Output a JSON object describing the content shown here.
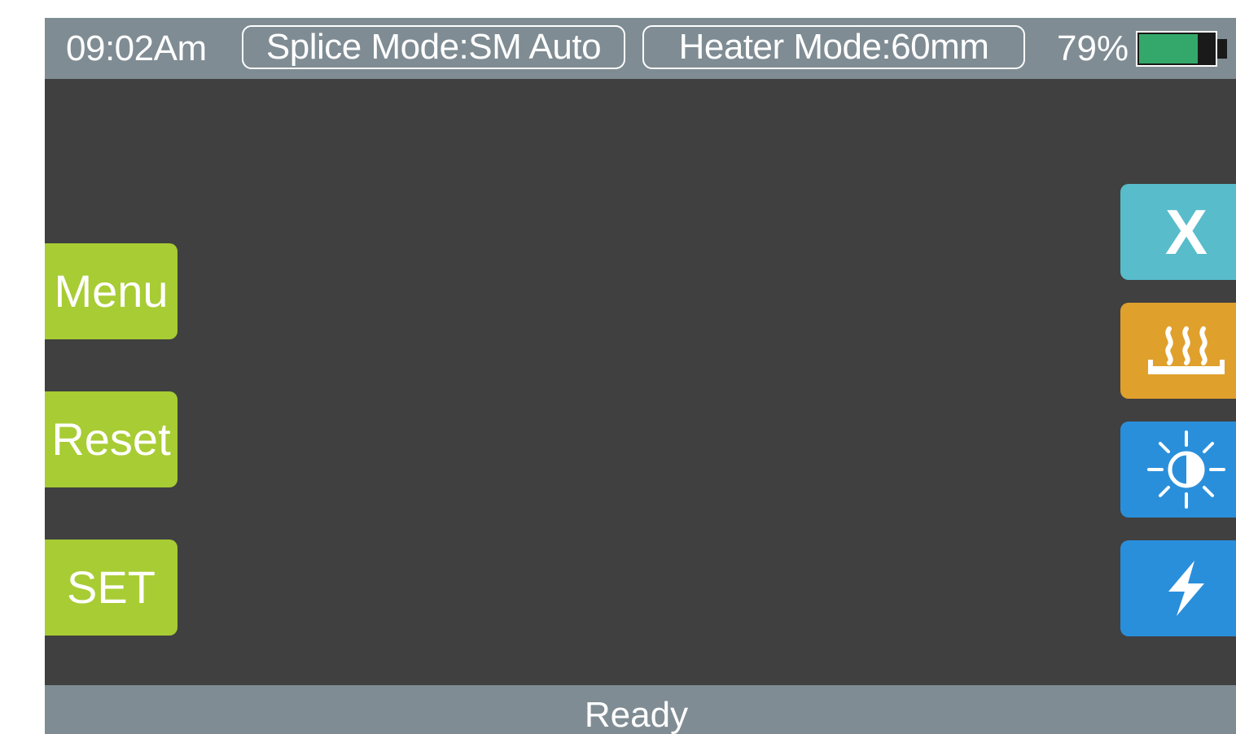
{
  "header": {
    "time": "09:02Am",
    "splice_mode": "Splice Mode:SM Auto",
    "heater_mode": "Heater Mode:60mm",
    "battery_percent_label": "79%",
    "battery_level": 0.79
  },
  "left_buttons": {
    "menu_label": "Menu",
    "reset_label": "Reset",
    "set_label": "SET"
  },
  "right_buttons": {
    "close_label": "X",
    "heater_icon": "heater-icon",
    "brightness_icon": "brightness-icon",
    "arc_icon": "lightning-icon"
  },
  "status": {
    "text": "Ready"
  },
  "colors": {
    "accent_green": "#a8cc34",
    "close_teal": "#58bccb",
    "heater_orange": "#e0a02c",
    "action_blue": "#2a8fdb",
    "bar_gray": "#7f8c93",
    "screen_dark": "#404040",
    "battery_green": "#34a86a"
  }
}
